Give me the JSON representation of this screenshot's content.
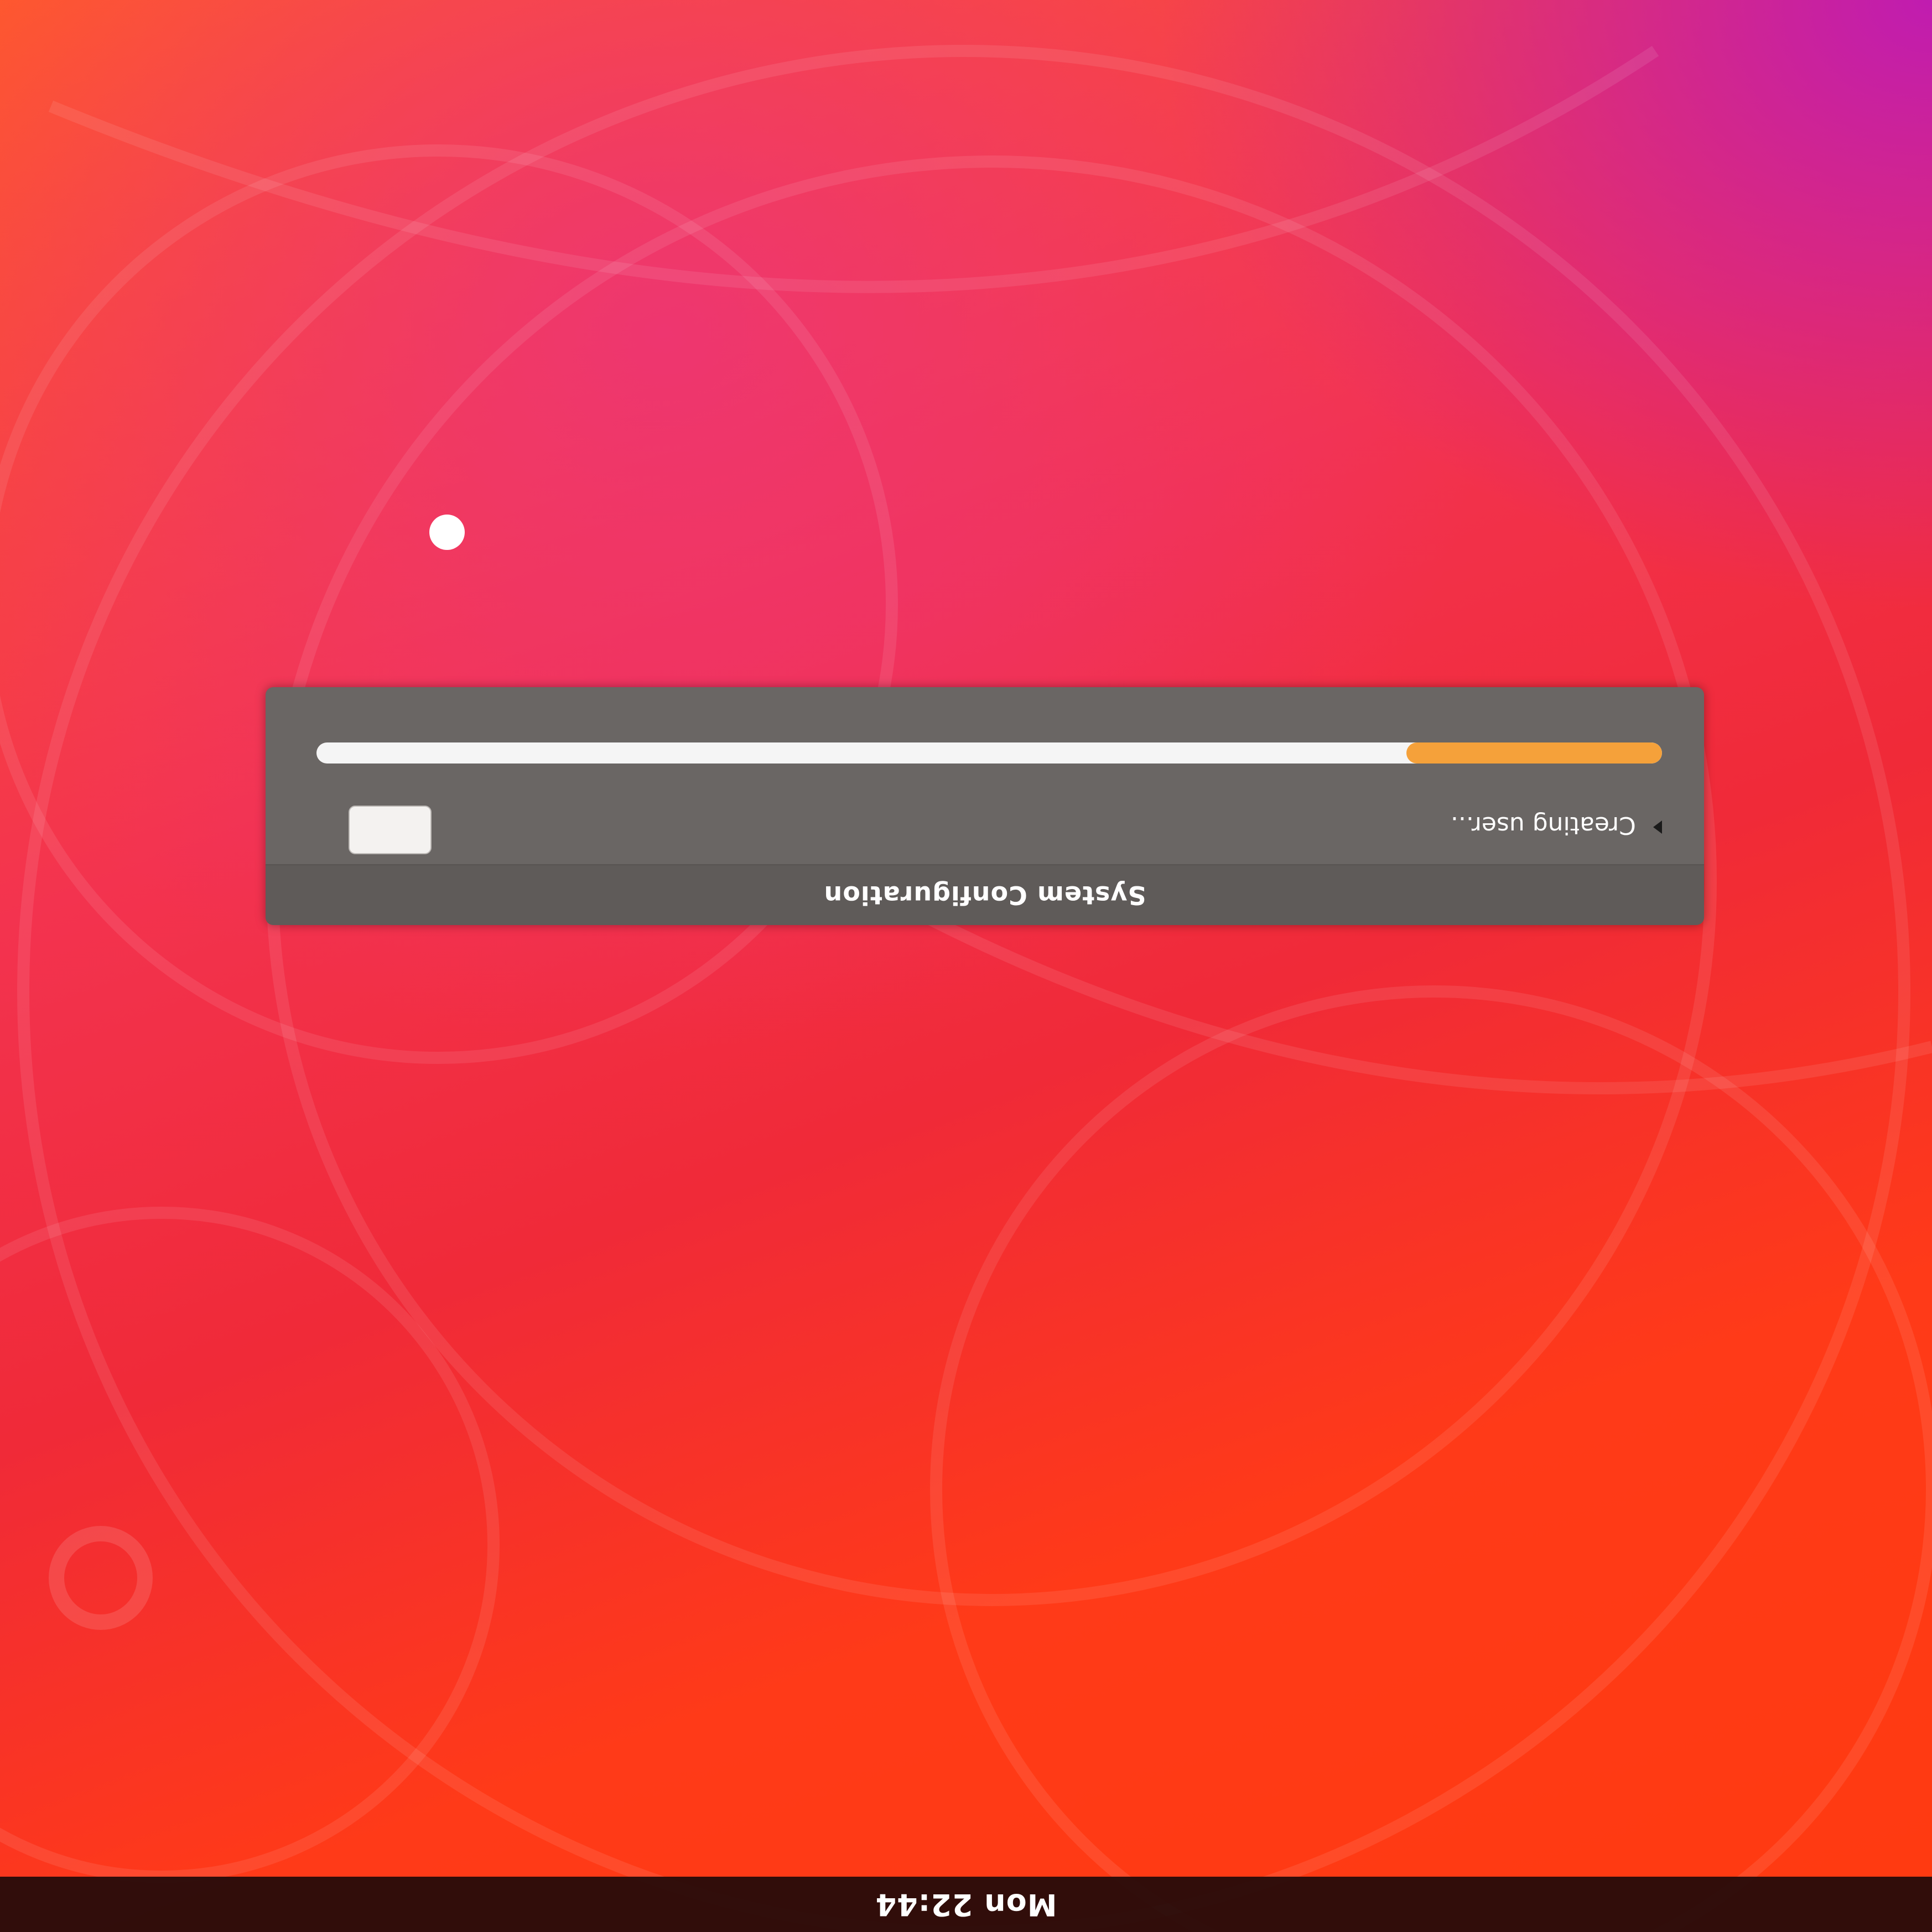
{
  "top_bar": {
    "clock": "Mon 22:44"
  },
  "dialog": {
    "title": "System Configuration",
    "status": "Creating user...",
    "cancel_label": "",
    "progress": 0.19
  },
  "colors": {
    "progress_accent": "#f5a13a",
    "dialog_bg": "#6a6664",
    "wallpaper_orange": "#ff3a18",
    "wallpaper_magenta": "#c01cb0"
  },
  "icons": {
    "expander": "triangle-right-icon",
    "cursor": "mouse-cursor"
  }
}
